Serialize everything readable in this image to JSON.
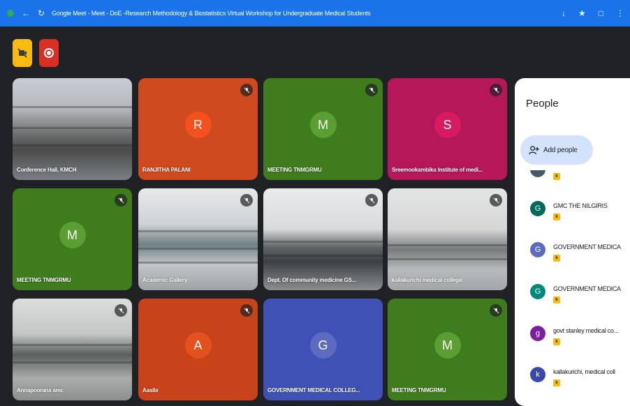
{
  "titlebar": {
    "title": "Google Meet - Meet - DoE -Research Methodology & Biostatistics Virtual Workshop for Undergraduate Medical Students"
  },
  "controls": {
    "camera_icon": "camera-off-icon",
    "record_icon": "record-icon"
  },
  "tiles": [
    {
      "name": "Conference Hall, KMCH",
      "type": "video"
    },
    {
      "name": "RANJITHA PALANI",
      "initial": "R",
      "color": "#d04a1f",
      "avatar_color": "#f4511e"
    },
    {
      "name": "MEETING TNMGRMU",
      "initial": "M",
      "color": "#3e7c1d",
      "avatar_color": "#5b9e32"
    },
    {
      "name": "Sreemookambika Institute of medi...",
      "initial": "S",
      "color": "#b51758",
      "avatar_color": "#d81b60"
    },
    {
      "name": "MEETING TNMGRMU",
      "initial": "M",
      "color": "#3e7c1d",
      "avatar_color": "#5b9e32"
    },
    {
      "name": "Academic Gallery",
      "type": "video"
    },
    {
      "name": "Dept. Of community medicine GS...",
      "type": "video"
    },
    {
      "name": "kallakurichi medical college",
      "type": "video"
    },
    {
      "name": "Annapoorana amc",
      "type": "video"
    },
    {
      "name": "Aasila",
      "initial": "A",
      "color": "#c8421a",
      "avatar_color": "#e4511e"
    },
    {
      "name": "GOVERNMENT MEDICAL COLLEG...",
      "initial": "G",
      "color": "#3f51b5",
      "avatar_color": "#5c6bc0"
    },
    {
      "name": "MEETING TNMGRMU",
      "initial": "M",
      "color": "#3e7c1d",
      "avatar_color": "#5b9e32"
    }
  ],
  "people_panel": {
    "title": "People",
    "add_people_label": "Add people",
    "participants": [
      {
        "initial": "G",
        "name": "GMC THE NILGIRIS",
        "color": "#00695c"
      },
      {
        "initial": "G",
        "name": "GOVERNMENT MEDICA",
        "color": "#5c6bc0"
      },
      {
        "initial": "G",
        "name": "GOVERNMENT MEDICA",
        "color": "#00897b"
      },
      {
        "initial": "g",
        "name": "govt stanley medical co...",
        "color": "#7b1fa2"
      },
      {
        "initial": "k",
        "name": "kallakurichi, medical coll",
        "color": "#3949ab"
      }
    ],
    "badge_label": "k"
  }
}
